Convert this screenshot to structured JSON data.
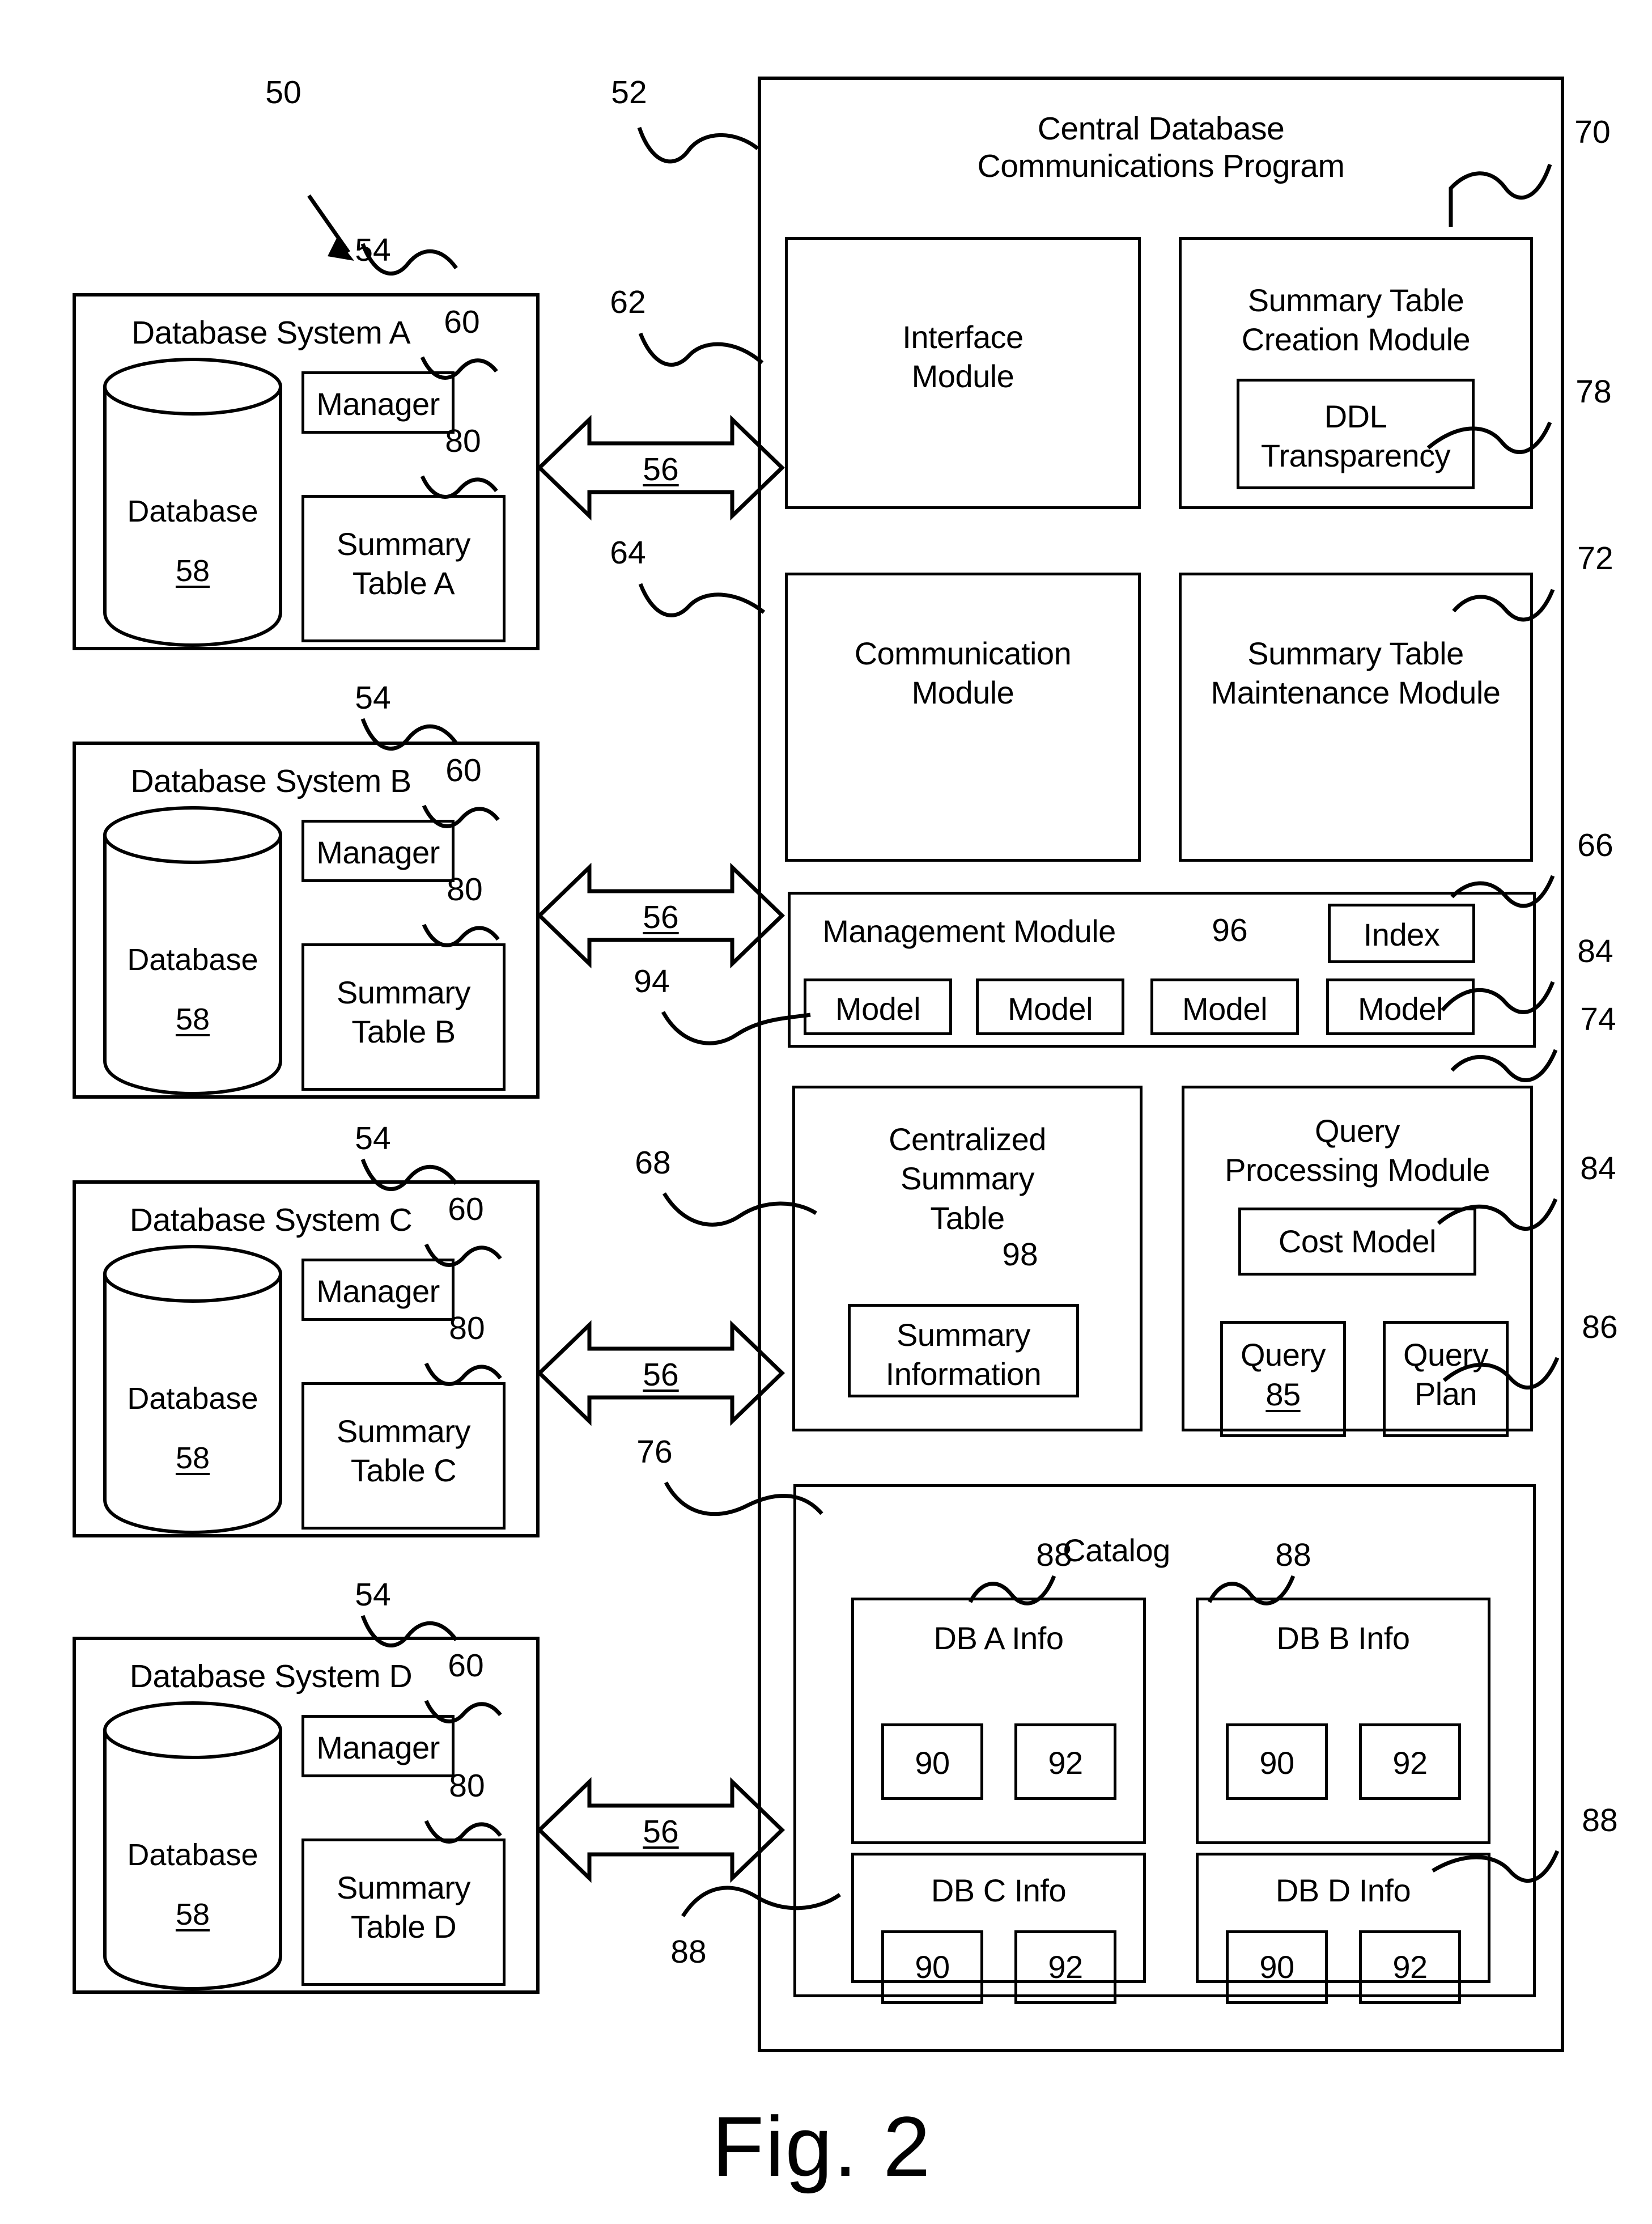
{
  "figure": {
    "caption": "Fig. 2",
    "system_ref": "50"
  },
  "central_program": {
    "title_line1": "Central Database",
    "title_line2": "Communications Program",
    "ref": "52",
    "modules": {
      "interface": {
        "label": "Interface\nModule",
        "ref": "62"
      },
      "communication": {
        "label": "Communication\nModule",
        "ref": "64"
      },
      "summary_creation": {
        "label": "Summary Table\nCreation Module",
        "ref": "70"
      },
      "ddl_transparency": {
        "label": "DDL\nTransparency",
        "ref": "78"
      },
      "summary_maintenance": {
        "label": "Summary Table\nMaintenance Module",
        "ref": "72"
      },
      "management": {
        "label": "Management Module",
        "ref": "66",
        "index_label": "Index",
        "index_ref": "96",
        "models_ref": "94",
        "models_right_ref": "84",
        "models": [
          "Model",
          "Model",
          "Model",
          "Model"
        ]
      },
      "centralized_summary_table": {
        "label": "Centralized\nSummary\nTable",
        "ref": "68",
        "summary_information_label": "Summary\nInformation",
        "summary_information_ref": "98"
      },
      "query_processing": {
        "label": "Query\nProcessing Module",
        "ref": "74",
        "cost_model_label": "Cost Model",
        "cost_model_ref": "84",
        "query_label": "Query",
        "query_number": "85",
        "query_plan_label": "Query\nPlan",
        "query_plan_ref": "86"
      },
      "catalog": {
        "label": "Catalog",
        "ref": "76",
        "entry_ref_top_left": "88",
        "entry_ref_top_right": "88",
        "entry_ref_bottom_left": "88",
        "entry_ref_bottom_right": "88",
        "entries": [
          {
            "label": "DB A Info",
            "sub": [
              "90",
              "92"
            ]
          },
          {
            "label": "DB B Info",
            "sub": [
              "90",
              "92"
            ]
          },
          {
            "label": "DB C Info",
            "sub": [
              "90",
              "92"
            ]
          },
          {
            "label": "DB D Info",
            "sub": [
              "90",
              "92"
            ]
          }
        ]
      }
    }
  },
  "database_systems": [
    {
      "title": "Database System A",
      "system_ref": "54",
      "manager_label": "Manager",
      "manager_ref": "60",
      "database_label": "Database",
      "database_ref": "58",
      "summary_table_label": "Summary\nTable A",
      "summary_table_ref": "80",
      "link_ref": "56"
    },
    {
      "title": "Database System B",
      "system_ref": "54",
      "manager_label": "Manager",
      "manager_ref": "60",
      "database_label": "Database",
      "database_ref": "58",
      "summary_table_label": "Summary\nTable B",
      "summary_table_ref": "80",
      "link_ref": "56"
    },
    {
      "title": "Database System C",
      "system_ref": "54",
      "manager_label": "Manager",
      "manager_ref": "60",
      "database_label": "Database",
      "database_ref": "58",
      "summary_table_label": "Summary\nTable C",
      "summary_table_ref": "80",
      "link_ref": "56"
    },
    {
      "title": "Database System D",
      "system_ref": "54",
      "manager_label": "Manager",
      "manager_ref": "60",
      "database_label": "Database",
      "database_ref": "58",
      "summary_table_label": "Summary\nTable D",
      "summary_table_ref": "80",
      "link_ref": "56"
    }
  ],
  "colors": {
    "line": "#000000",
    "background": "#ffffff"
  }
}
